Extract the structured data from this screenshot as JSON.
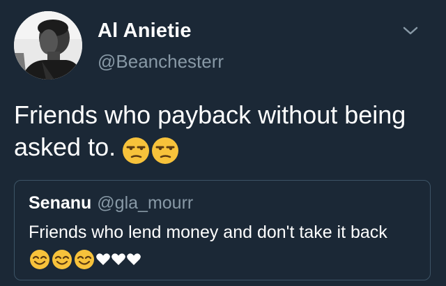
{
  "tweet": {
    "author": {
      "display_name": "Al Anietie",
      "handle": "@Beanchesterr",
      "avatar_icon": "profile-photo"
    },
    "menu_icon": "chevron-down-icon",
    "text": "Friends who payback without being asked to.",
    "text_emojis": [
      "unamused-face",
      "unamused-face"
    ],
    "quoted_tweet": {
      "display_name": "Senanu",
      "handle": "@gla_mourr",
      "text": "Friends who lend money and don't take it back",
      "emojis": [
        "smiling-eyes-face",
        "smiling-eyes-face",
        "smiling-eyes-face",
        "white-heart",
        "white-heart",
        "white-heart"
      ]
    }
  },
  "colors": {
    "background": "#1b2836",
    "primary_text": "#ffffff",
    "secondary_text": "#8899a6",
    "quote_border": "#3d5466",
    "emoji_yellow": "#f7c23b"
  }
}
